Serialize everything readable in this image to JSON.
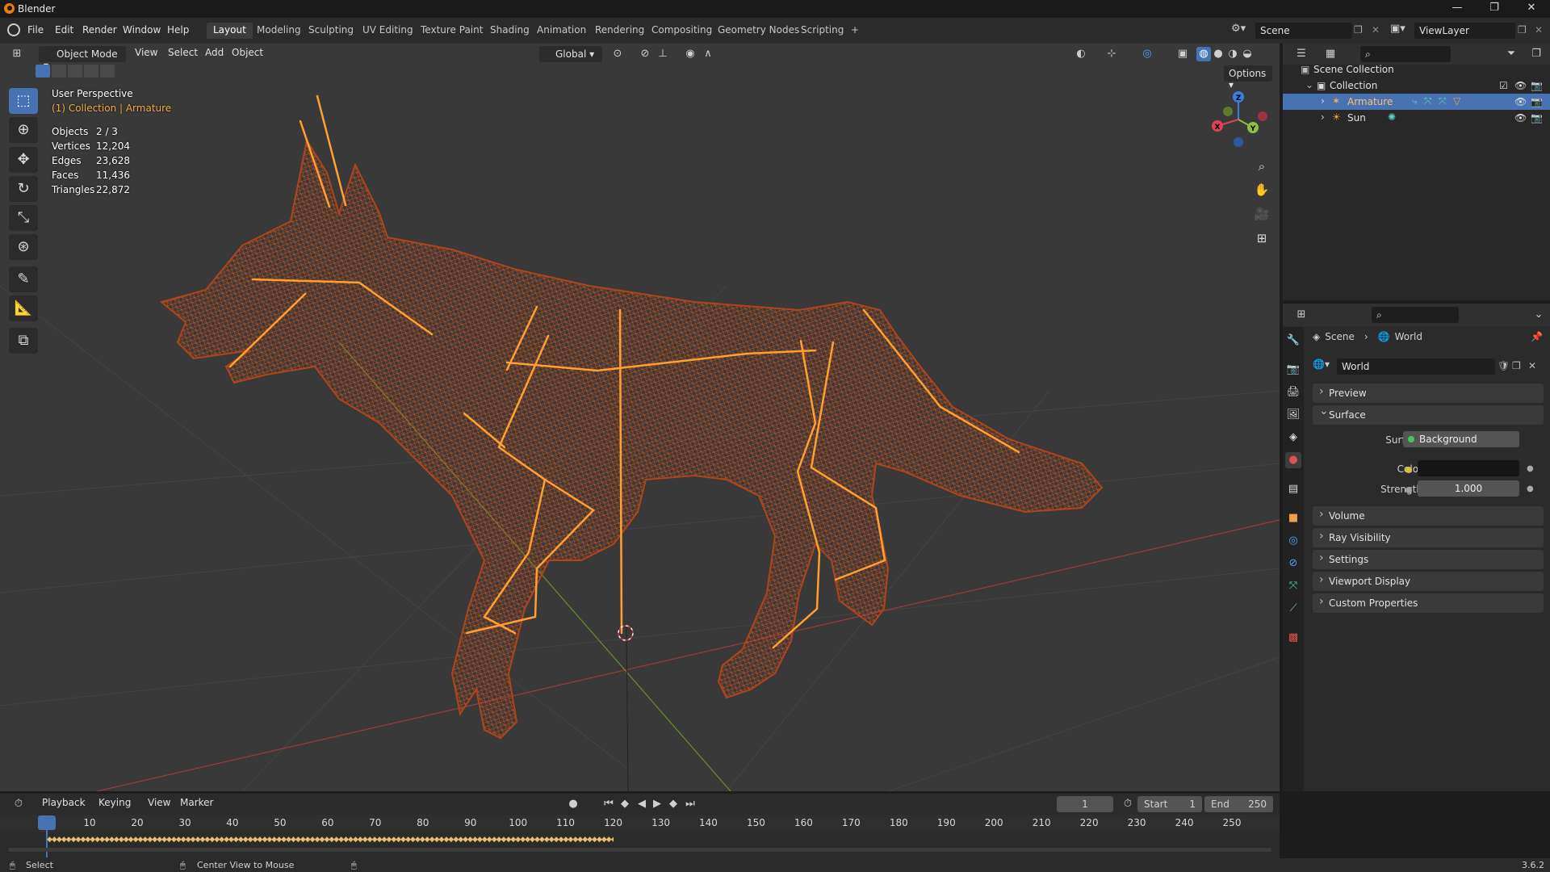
{
  "app": {
    "window_title": "Blender",
    "menus": [
      "File",
      "Edit",
      "Render",
      "Window",
      "Help"
    ],
    "workspaces": [
      "Layout",
      "Modeling",
      "Sculpting",
      "UV Editing",
      "Texture Paint",
      "Shading",
      "Animation",
      "Rendering",
      "Compositing",
      "Geometry Nodes",
      "Scripting"
    ],
    "active_workspace": "Layout",
    "add_workspace": "+",
    "scene": "Scene",
    "view_layer": "ViewLayer"
  },
  "viewport_header": {
    "mode": "Object Mode",
    "menus": [
      "View",
      "Select",
      "Add",
      "Object"
    ],
    "orientation": "Global",
    "options": "Options"
  },
  "overlay": {
    "perspective": "User Perspective",
    "context": "(1) Collection | Armature",
    "stats": [
      {
        "label": "Objects",
        "value": "2 / 3"
      },
      {
        "label": "Vertices",
        "value": "12,204"
      },
      {
        "label": "Edges",
        "value": "23,628"
      },
      {
        "label": "Faces",
        "value": "11,436"
      },
      {
        "label": "Triangles",
        "value": "22,872"
      }
    ]
  },
  "gizmo": {
    "x": "X",
    "y": "Y",
    "z": "Z"
  },
  "outliner": {
    "root": "Scene Collection",
    "collection": "Collection",
    "items": [
      "Armature",
      "Sun"
    ]
  },
  "properties": {
    "breadcrumb": [
      "Scene",
      "World"
    ],
    "world_name": "World",
    "panels": {
      "preview": "Preview",
      "surface": "Surface",
      "volume": "Volume",
      "ray_visibility": "Ray Visibility",
      "settings": "Settings",
      "viewport_display": "Viewport Display",
      "custom_properties": "Custom Properties"
    },
    "surface_label": "Surface",
    "surface_value": "Background",
    "color_label": "Color",
    "strength_label": "Strength",
    "strength_value": "1.000"
  },
  "timeline": {
    "menus": [
      "Playback",
      "Keying",
      "View",
      "Marker"
    ],
    "current_frame": "1",
    "start_label": "Start",
    "start_value": "1",
    "end_label": "End",
    "end_value": "250",
    "ticks": [
      "1",
      "10",
      "20",
      "30",
      "40",
      "50",
      "60",
      "70",
      "80",
      "90",
      "100",
      "110",
      "120",
      "130",
      "140",
      "150",
      "160",
      "170",
      "180",
      "190",
      "200",
      "210",
      "220",
      "230",
      "240",
      "250"
    ],
    "keyframe_end": 120
  },
  "statusbar": {
    "select": "Select",
    "center": "Center View to Mouse",
    "version": "3.6.2"
  },
  "colors": {
    "accent": "#4772b3",
    "wire": "#c8501c",
    "bone": "#ffa030"
  }
}
